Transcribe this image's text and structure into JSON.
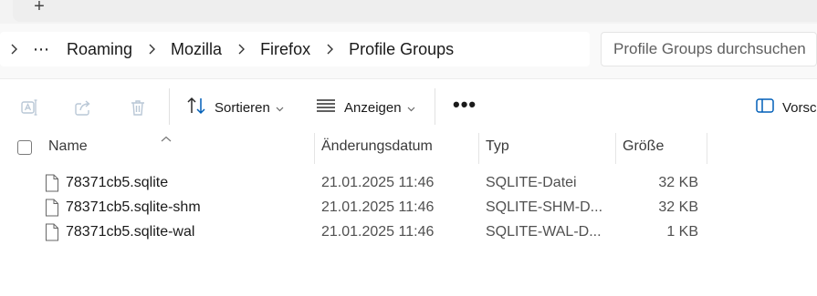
{
  "tabstrip": {
    "newtab_glyph": "+"
  },
  "breadcrumb": {
    "overflow": "⋯",
    "items": [
      "Roaming",
      "Mozilla",
      "Firefox",
      "Profile Groups"
    ]
  },
  "search": {
    "placeholder": "Profile Groups durchsuchen"
  },
  "toolbar": {
    "sort_label": "Sortieren",
    "view_label": "Anzeigen",
    "more_label": "•••",
    "preview_label": "Vorschau"
  },
  "columns": {
    "name": "Name",
    "modified": "Änderungsdatum",
    "type": "Typ",
    "size": "Größe"
  },
  "files": [
    {
      "name": "78371cb5.sqlite",
      "modified": "21.01.2025 11:46",
      "type": "SQLITE-Datei",
      "size": "32 KB"
    },
    {
      "name": "78371cb5.sqlite-shm",
      "modified": "21.01.2025 11:46",
      "type": "SQLITE-SHM-D...",
      "size": "32 KB"
    },
    {
      "name": "78371cb5.sqlite-wal",
      "modified": "21.01.2025 11:46",
      "type": "SQLITE-WAL-D...",
      "size": "1 KB"
    }
  ],
  "colors": {
    "icon_disabled": "#b9c7d6",
    "icon_active": "#2b2b2b",
    "accent": "#005fb8"
  }
}
